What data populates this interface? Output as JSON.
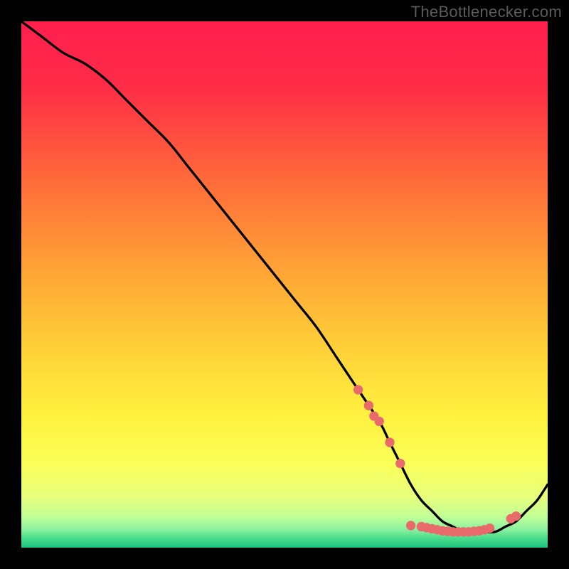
{
  "watermark": "TheBottlenecker.com",
  "gradient_stops": [
    {
      "offset": 0.0,
      "color": "#ff1f4d"
    },
    {
      "offset": 0.12,
      "color": "#ff2b47"
    },
    {
      "offset": 0.3,
      "color": "#ff6a3a"
    },
    {
      "offset": 0.48,
      "color": "#ffa636"
    },
    {
      "offset": 0.62,
      "color": "#ffd038"
    },
    {
      "offset": 0.75,
      "color": "#fff13f"
    },
    {
      "offset": 0.84,
      "color": "#fbff58"
    },
    {
      "offset": 0.9,
      "color": "#e9ff7a"
    },
    {
      "offset": 0.94,
      "color": "#c4ff96"
    },
    {
      "offset": 0.965,
      "color": "#8cf2a0"
    },
    {
      "offset": 0.985,
      "color": "#3fd989"
    },
    {
      "offset": 1.0,
      "color": "#1fbf7a"
    }
  ],
  "chart_data": {
    "type": "line",
    "title": "",
    "xlabel": "",
    "ylabel": "",
    "xlim": [
      0,
      100
    ],
    "ylim": [
      0,
      100
    ],
    "series": [
      {
        "name": "curve",
        "x": [
          0,
          4,
          8,
          12,
          16,
          20,
          24,
          28,
          32,
          36,
          40,
          44,
          48,
          52,
          56,
          60,
          64,
          68,
          70,
          72,
          74,
          76,
          78,
          80,
          82,
          84,
          86,
          88,
          90,
          92,
          94,
          96,
          98,
          100
        ],
        "y": [
          100,
          97,
          94,
          92,
          89,
          85,
          81,
          77,
          72,
          67,
          62,
          57,
          52,
          47,
          42,
          36,
          30,
          24,
          20,
          16,
          12,
          9,
          7,
          5,
          4,
          3,
          3,
          3,
          3,
          4,
          5,
          7,
          9,
          12
        ]
      }
    ],
    "markers": [
      {
        "x": 64,
        "y": 30
      },
      {
        "x": 66,
        "y": 27
      },
      {
        "x": 67,
        "y": 25
      },
      {
        "x": 68,
        "y": 24
      },
      {
        "x": 70,
        "y": 20
      },
      {
        "x": 72,
        "y": 16
      },
      {
        "x": 74,
        "y": 4.2
      },
      {
        "x": 76,
        "y": 4.0
      },
      {
        "x": 77,
        "y": 3.8
      },
      {
        "x": 78,
        "y": 3.6
      },
      {
        "x": 79,
        "y": 3.4
      },
      {
        "x": 80,
        "y": 3.2
      },
      {
        "x": 81,
        "y": 3.1
      },
      {
        "x": 82,
        "y": 3.0
      },
      {
        "x": 83,
        "y": 3.0
      },
      {
        "x": 84,
        "y": 3.0
      },
      {
        "x": 85,
        "y": 3.0
      },
      {
        "x": 86,
        "y": 3.1
      },
      {
        "x": 87,
        "y": 3.2
      },
      {
        "x": 88,
        "y": 3.4
      },
      {
        "x": 89,
        "y": 3.7
      },
      {
        "x": 93,
        "y": 5.5
      },
      {
        "x": 94,
        "y": 6.0
      }
    ],
    "marker_color": "#e86a6a",
    "curve_color": "#000000"
  }
}
